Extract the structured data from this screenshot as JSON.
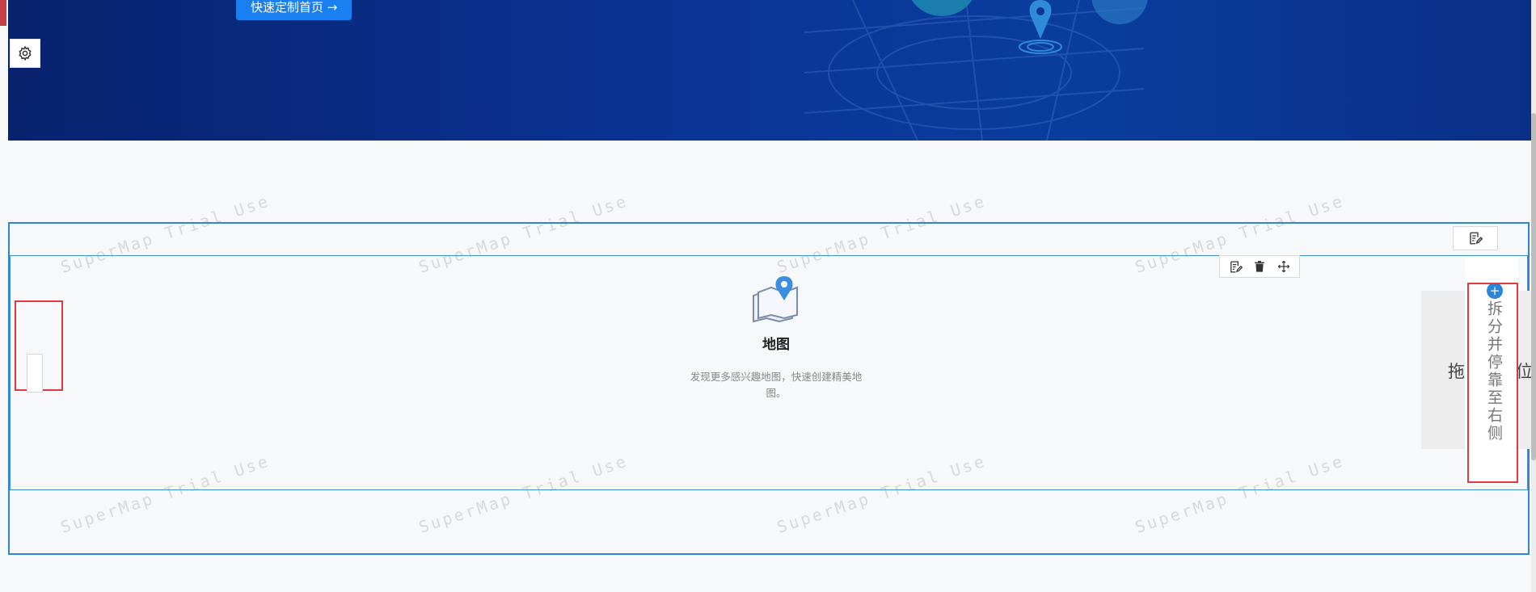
{
  "banner": {
    "cta_label": "快速定制首页 →"
  },
  "settings": {
    "icon": "gear-icon"
  },
  "toolbar": {
    "row_edit_icon": "edit-icon",
    "edit_icon": "edit-icon",
    "delete_icon": "trash-icon",
    "move_icon": "move-icon"
  },
  "map_widget": {
    "icon": "map-pin-icon",
    "title": "地图",
    "description": "发现更多感兴趣地图，快速创建精美地图。"
  },
  "drop_hint": {
    "new_position_text": "拖动至新位",
    "split_text": "拆分并停靠至右侧"
  },
  "watermark": {
    "text": "SuperMap Trial Use"
  },
  "colors": {
    "accent": "#2b86d8",
    "banner": "#0a3496",
    "highlight_outline": "#e0393e",
    "button": "#1a7ff0"
  }
}
